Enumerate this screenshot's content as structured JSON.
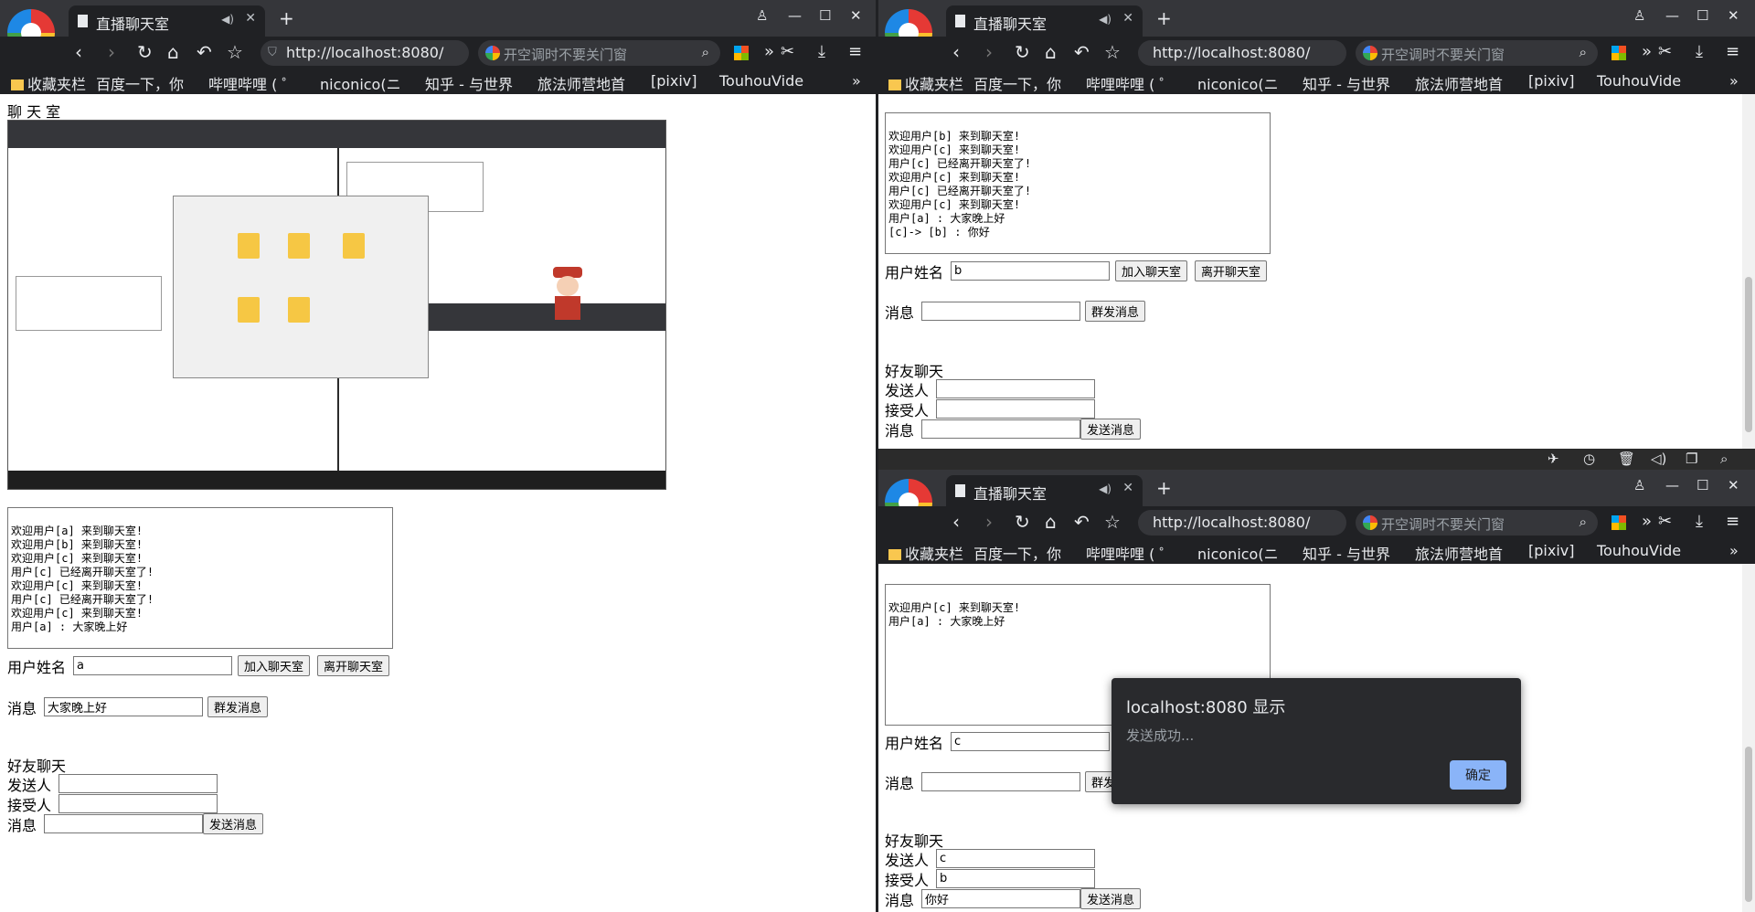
{
  "browser": {
    "tab_title": "直播聊天室",
    "url": "http://localhost:8080/",
    "search_placeholder": "开空调时不要关门窗",
    "bookmarks": [
      "收藏夹栏",
      "百度一下，你",
      "哔哩哔哩 ( ゜",
      "niconico(ニ",
      "知乎 - 与世界",
      "旅法师营地首",
      "[pixiv]",
      "TouhouVide"
    ],
    "bookmarks_more": "»"
  },
  "left": {
    "page_title": "聊 天 室",
    "chat_log": "欢迎用户[a] 来到聊天室!\n欢迎用户[b] 来到聊天室!\n欢迎用户[c] 来到聊天室!\n用户[c] 已经离开聊天室了!\n欢迎用户[c] 来到聊天室!\n用户[c] 已经离开聊天室了!\n欢迎用户[c] 来到聊天室!\n用户[a] : 大家晚上好",
    "username_value": "a",
    "message_value": "大家晚上好",
    "friend_sender": "",
    "friend_receiver": "",
    "friend_message": ""
  },
  "top_right": {
    "chat_log": "欢迎用户[b] 来到聊天室!\n欢迎用户[c] 来到聊天室!\n用户[c] 已经离开聊天室了!\n欢迎用户[c] 来到聊天室!\n用户[c] 已经离开聊天室了!\n欢迎用户[c] 来到聊天室!\n用户[a] : 大家晚上好\n[c]-> [b] : 你好",
    "username_value": "b",
    "message_value": "",
    "friend_sender": "",
    "friend_receiver": "",
    "friend_message": ""
  },
  "bottom_right": {
    "chat_log": "欢迎用户[c] 来到聊天室!\n用户[a] : 大家晚上好",
    "username_value": "c",
    "message_value": "",
    "friend_sender": "c",
    "friend_receiver": "b",
    "friend_message": "你好"
  },
  "labels": {
    "username": "用户姓名",
    "join": "加入聊天室",
    "leave": "离开聊天室",
    "message": "消息",
    "broadcast": "群发消息",
    "friend_chat": "好友聊天",
    "sender": "发送人",
    "receiver": "接受人",
    "send": "发送消息"
  },
  "alert": {
    "title": "localhost:8080 显示",
    "message": "发送成功...",
    "ok": "确定"
  },
  "colors": {
    "chrome_dark": "#202124",
    "tab_strip": "#35363a",
    "alert_button": "#8ab4f8"
  }
}
